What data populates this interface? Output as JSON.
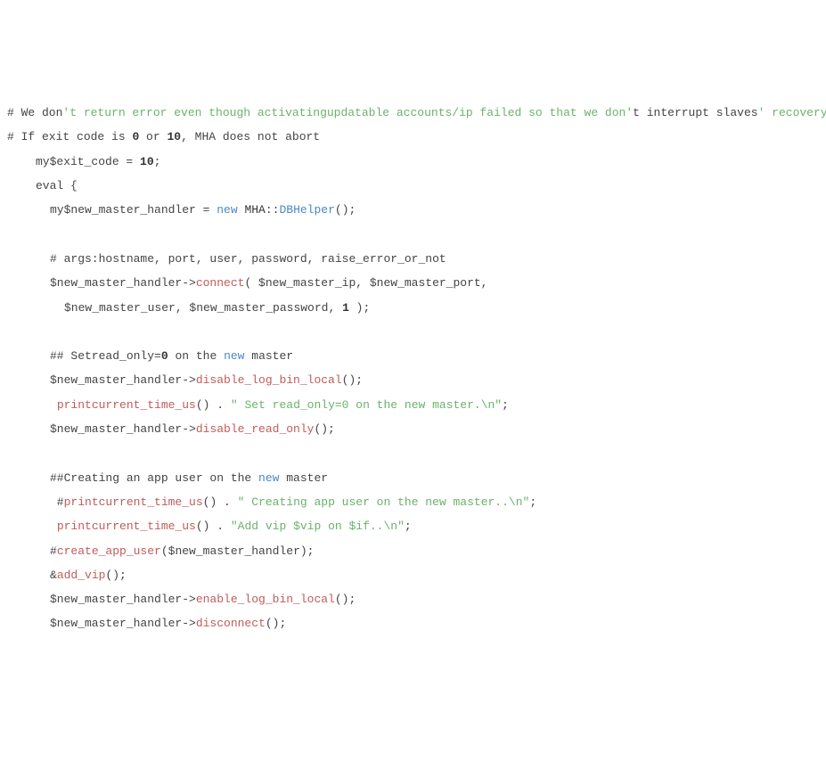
{
  "lines": {
    "l1_hash": "# We don",
    "l1_str": "'t return error even though activatingupdatable accounts/ip failed so that we don'",
    "l1_tail": "t interrupt slaves",
    "l1_str2": "' recovery.",
    "l2_a": "# If exit code is ",
    "l2_n1": "0",
    "l2_b": " or ",
    "l2_n2": "10",
    "l2_c": ", MHA does not abort",
    "l3_a": "my$exit_code = ",
    "l3_n": "10",
    "l3_b": ";",
    "l4_a": "eval {",
    "l5_a": "my$new_master_handler = ",
    "l5_kw": "new",
    "l5_sp": " ",
    "l5_pkg1": "MHA",
    "l5_cc": "::",
    "l5_pkg2": "DBHelper",
    "l5_b": "();",
    "l6_a": "# args:hostname, port, user, password, raise_error_or_not",
    "l7_a": "$new_master_handler->",
    "l7_m": "connect",
    "l7_b": "( $new_master_ip, $new_master_port,",
    "l8_a": "$new_master_user, $new_master_password, ",
    "l8_n": "1",
    "l8_b": " );",
    "l9_a": "## Setread_only=",
    "l9_n": "0",
    "l9_b": " on the ",
    "l9_kw": "new",
    "l9_c": " master",
    "l10_a": "$new_master_handler->",
    "l10_m": "disable_log_bin_local",
    "l10_b": "();",
    "l11_sp": " ",
    "l11_f": "printcurrent_time_us",
    "l11_a": "() . ",
    "l11_s": "\" Set read_only=0 on the new master.\\n\"",
    "l11_b": ";",
    "l12_a": "$new_master_handler->",
    "l12_m": "disable_read_only",
    "l12_b": "();",
    "l13_a": "##Creating an app user on the ",
    "l13_kw": "new",
    "l13_b": " master",
    "l14_sp": " #",
    "l14_f": "printcurrent_time_us",
    "l14_a": "() . ",
    "l14_s": "\" Creating app user on the new master..\\n\"",
    "l14_b": ";",
    "l15_sp": " ",
    "l15_f": "printcurrent_time_us",
    "l15_a": "() . ",
    "l15_s": "\"Add vip $vip on $if..\\n\"",
    "l15_b": ";",
    "l16_a": "#",
    "l16_f": "create_app_user",
    "l16_b": "($new_master_handler);",
    "l17_a": "&",
    "l17_f": "add_vip",
    "l17_b": "();",
    "l18_a": "$new_master_handler->",
    "l18_m": "enable_log_bin_local",
    "l18_b": "();",
    "l19_a": "$new_master_handler->",
    "l19_m": "disconnect",
    "l19_b": "();"
  }
}
